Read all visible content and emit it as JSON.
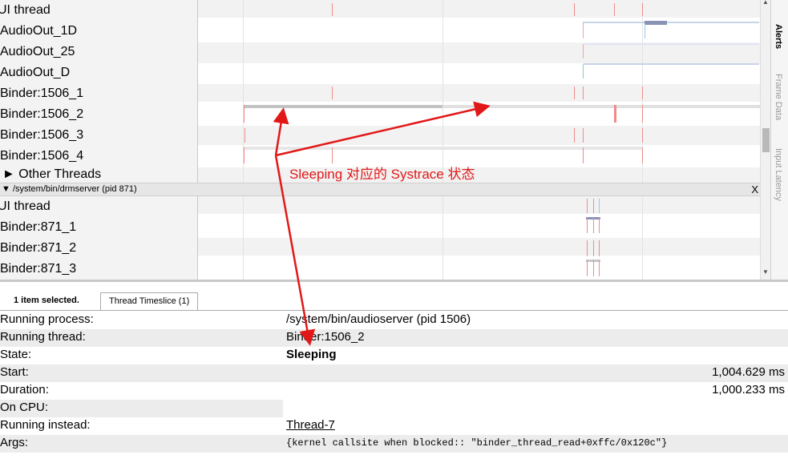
{
  "tracks": {
    "labels": [
      "UI thread",
      "AudioOut_1D",
      "AudioOut_25",
      "AudioOut_D",
      "Binder:1506_1",
      "Binder:1506_2",
      "Binder:1506_3",
      "Binder:1506_4"
    ],
    "other_threads": "► Other Threads",
    "process_header": "▼ /system/bin/drmserver (pid 871)",
    "process_close": "X",
    "labels2": [
      "UI thread",
      "Binder:871_1",
      "Binder:871_2",
      "Binder:871_3"
    ]
  },
  "side_tabs": [
    "Alerts",
    "Frame Data",
    "Input Latency"
  ],
  "annotation": {
    "text": "Sleeping 对应的 Systrace 状态",
    "color": "#e21818"
  },
  "analysis": {
    "selection_label": "1 item selected.",
    "tab_label": "Thread Timeslice (1)",
    "rows": [
      {
        "key": "Running process:",
        "value": "/system/bin/audioserver (pid 1506)"
      },
      {
        "key": "Running thread:",
        "value": "Binder:1506_2"
      },
      {
        "key": "State:",
        "value": "Sleeping"
      },
      {
        "key": "Start:",
        "value": "1,004.629 ms"
      },
      {
        "key": "Duration:",
        "value": "1,000.233 ms"
      },
      {
        "key": "On CPU:",
        "value": ""
      },
      {
        "key": "Running instead:",
        "value": "Thread-7"
      },
      {
        "key": "Args:",
        "value": "{kernel callsite when blocked:: \"binder_thread_read+0xffc/0x120c\"}"
      }
    ]
  }
}
